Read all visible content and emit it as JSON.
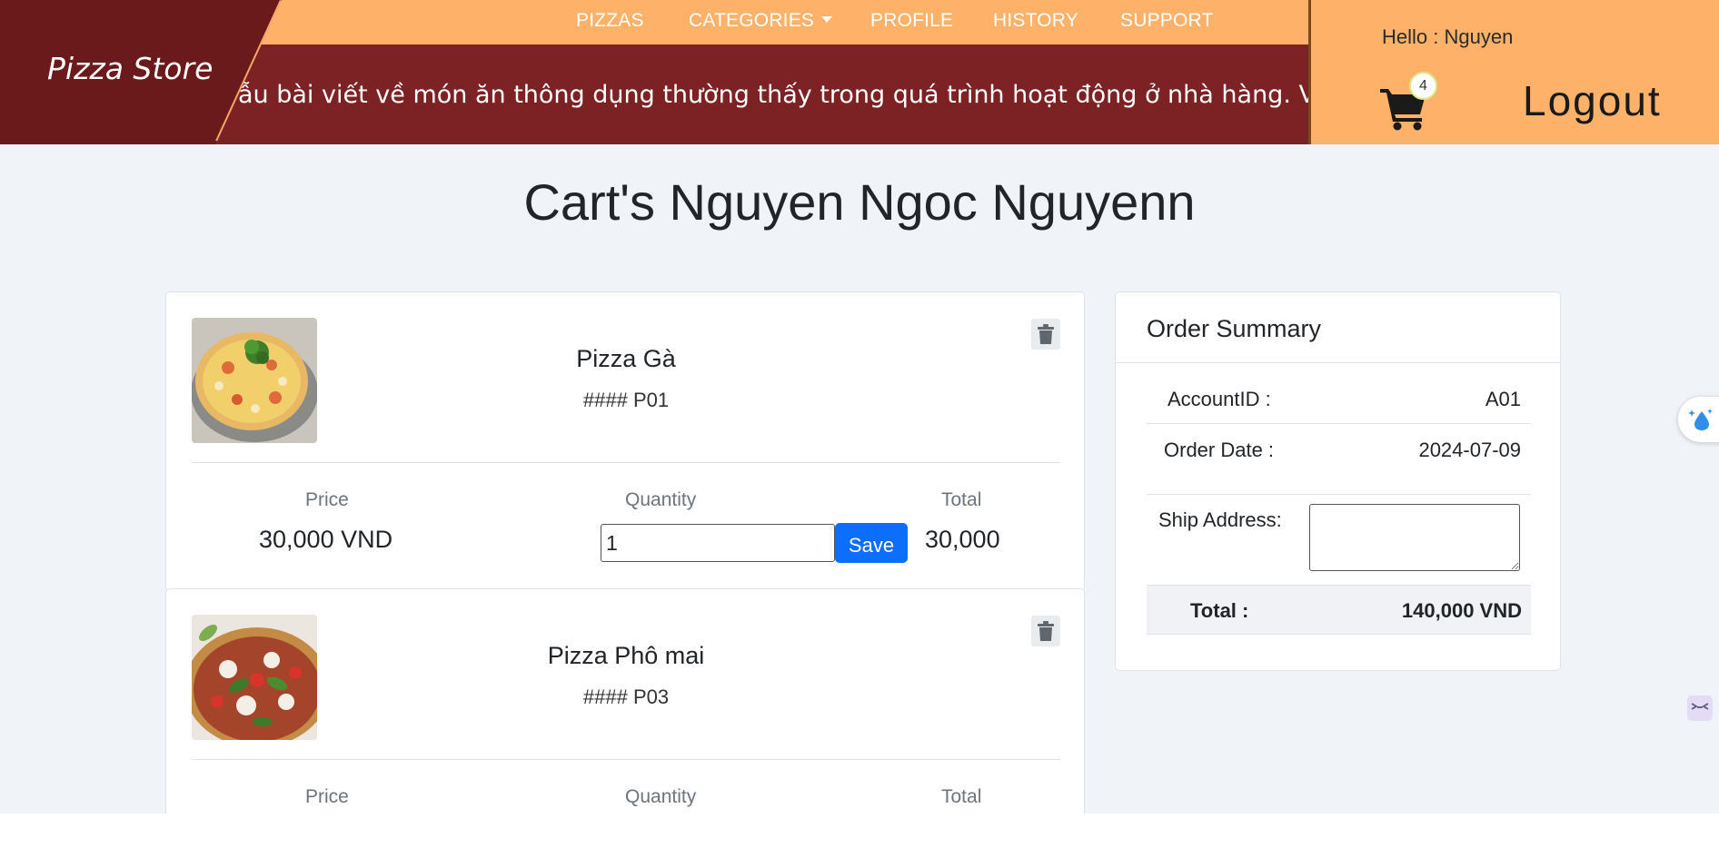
{
  "brand": {
    "name": "Pizza Store"
  },
  "nav": {
    "items": [
      "PIZZAS",
      "CATEGORIES",
      "PROFILE",
      "HISTORY",
      "SUPPORT"
    ]
  },
  "marquee": {
    "text": "ẫu bài viết về món ăn thông dụng thường thấy trong quá trình hoạt động ở nhà hàng. Việc chia s"
  },
  "user": {
    "greeting": "Hello : Nguyen",
    "cart_count": "4",
    "logout_label": "Logout"
  },
  "page": {
    "title": "Cart's Nguyen Ngoc Nguyenn"
  },
  "cart": {
    "col_labels": {
      "price": "Price",
      "quantity": "Quantity",
      "total": "Total"
    },
    "save_label": "Save",
    "items": [
      {
        "name": "Pizza Gà",
        "code": "#### P01",
        "price": "30,000 VND",
        "quantity": "1",
        "total": "30,000"
      },
      {
        "name": "Pizza Phô mai",
        "code": "#### P03"
      }
    ]
  },
  "summary": {
    "title": "Order Summary",
    "account_label": "AccountID :",
    "account_value": "A01",
    "date_label": "Order Date :",
    "date_value": "2024-07-09",
    "address_label": "Ship Address:",
    "total_label": "Total :",
    "total_value": "140,000 VND"
  },
  "colors": {
    "nav_bg": "#feb168",
    "marquee_bg": "#7d2224",
    "brand_bg": "#6b1a1b",
    "save_button": "#0d6efd",
    "page_bg": "#f0f3f7"
  }
}
